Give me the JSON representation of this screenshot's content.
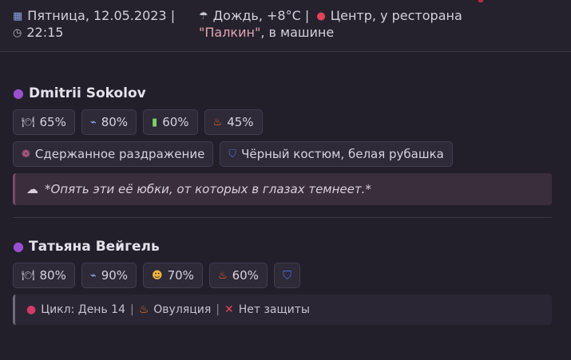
{
  "header": {
    "date": "Пятница, 12.05.2023 |",
    "time": "22:15",
    "weather": "Дождь, +8°C |",
    "location_prefix": "Центр, у ресторана",
    "location_highlight": "\"Палкин\"",
    "location_suffix": ", в машине",
    "icons": {
      "date": "calendar-icon",
      "time": "clock-icon",
      "weather": "rain-cloud-icon",
      "location": "pin-icon"
    }
  },
  "characters": [
    {
      "name": "Dmitrii Sokolov",
      "stats": [
        {
          "icon": "plate-icon",
          "value": "65%"
        },
        {
          "icon": "broom-icon",
          "value": "80%"
        },
        {
          "icon": "battery-icon",
          "value": "60%"
        },
        {
          "icon": "fire-icon",
          "value": "45%"
        }
      ],
      "mood": "Сдержанное раздражение",
      "outfit": "Чёрный костюм, белая рубашка",
      "thought": "*Опять эти её юбки, от которых в глазах темнеет.*"
    },
    {
      "name": "Татьяна Вейгель",
      "stats": [
        {
          "icon": "plate-icon",
          "value": "80%"
        },
        {
          "icon": "broom-icon",
          "value": "90%"
        },
        {
          "icon": "sleepy-face-icon",
          "value": "70%"
        },
        {
          "icon": "fire-icon",
          "value": "60%"
        }
      ],
      "outfit_icon": "jeans-icon",
      "cycle": {
        "day": "Цикл: День 14",
        "phase": "Овуляция",
        "protection": "Нет защиты"
      }
    }
  ],
  "colors": {
    "background": "#221f2a",
    "chip": "#2e2a38",
    "thought_bg": "#3a2e3c",
    "accent": "#9a4fd0",
    "highlight": "#e0a5b4"
  }
}
